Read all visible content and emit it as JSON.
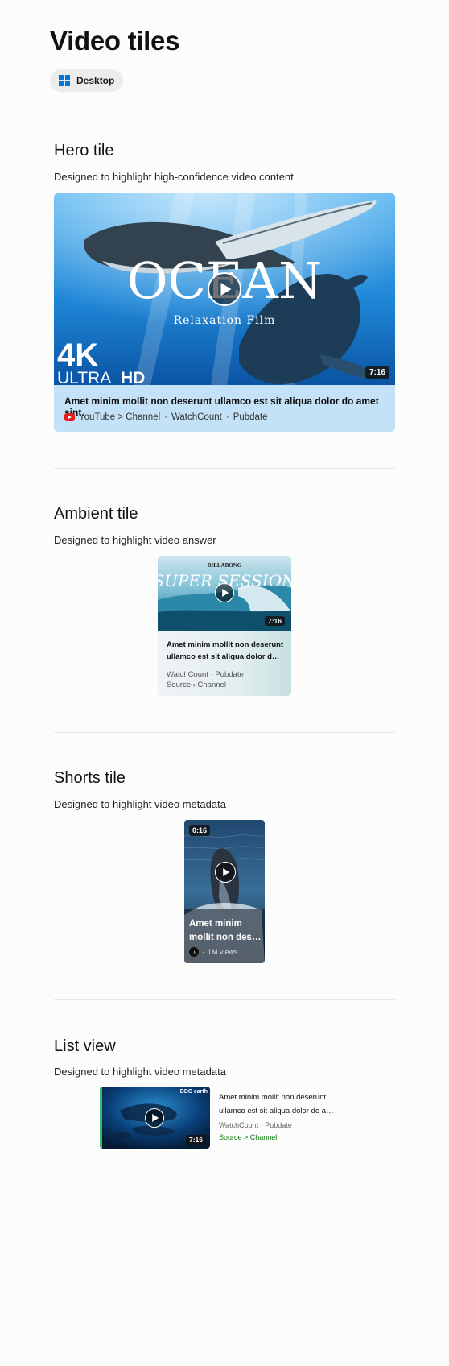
{
  "page": {
    "title": "Video tiles"
  },
  "platform": {
    "label": "Desktop",
    "icon": "windows-logo-icon",
    "accent": "#0a74da"
  },
  "hero": {
    "heading": "Hero tile",
    "subheading": "Designed to highlight high-confidence video content",
    "thumbnail": {
      "line1": "OCEAN",
      "line2": "Relaxation Film",
      "badge_big": "4K",
      "badge_small1": "ULTRA",
      "badge_small2": "HD"
    },
    "duration": "7:16",
    "title": "Amet minim mollit non deserunt ullamco est sit aliqua dolor do amet sint.",
    "source": "YouTube > Channel",
    "watch_count": "WatchCount",
    "pubdate": "Pubdate",
    "source_icon": "youtube-icon",
    "brand_color": "#e21b1b"
  },
  "ambient": {
    "heading": "Ambient tile",
    "subheading": "Designed to highlight video answer",
    "thumbnail": {
      "logo": "BILLABONG",
      "text": "SUPER SESSION"
    },
    "duration": "7:16",
    "title_line1": "Amet minim mollit non deserunt",
    "title_line2": "ullamco est sit aliqua dolor do a…",
    "watch_count": "WatchCount",
    "pubdate": "Pubdate",
    "source": "Source › Channel"
  },
  "shorts": {
    "heading": "Shorts tile",
    "subheading": "Designed to highlight video metadata",
    "duration": "0:16",
    "title_line1": "Amet minim",
    "title_line2": "mollit non deser…",
    "views": "1M views",
    "source_icon": "tiktok-icon"
  },
  "list": {
    "heading": "List view",
    "subheading": "Designed to highlight video metadata",
    "thumbnail": {
      "logo": "BBC earth"
    },
    "duration": "7:16",
    "title_line1": "Amet minim mollit non deserunt",
    "title_line2": "ullamco est sit aliqua dolor do a…",
    "watch_count": "WatchCount",
    "pubdate": "Pubdate",
    "source": "Source > Channel",
    "source_color": "#107c10"
  }
}
